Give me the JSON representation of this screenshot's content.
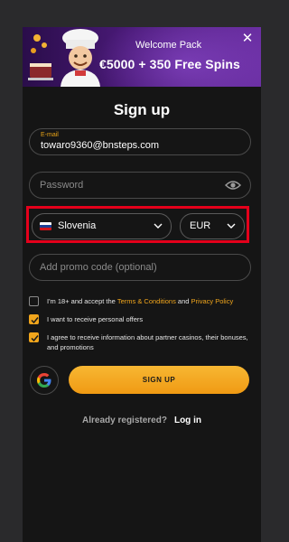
{
  "banner": {
    "title": "Welcome Pack",
    "offer": "€5000 + 350 Free Spins",
    "close_icon": "close-icon"
  },
  "form": {
    "heading": "Sign up",
    "email": {
      "label": "E-mail",
      "value": "towaro9360@bnsteps.com"
    },
    "password": {
      "placeholder": "Password",
      "toggle_icon": "eye-icon"
    },
    "country": {
      "value": "Slovenia",
      "flag_icon": "slovenia-flag-icon"
    },
    "currency": {
      "value": "EUR"
    },
    "promo": {
      "placeholder": "Add promo code (optional)"
    },
    "checkboxes": [
      {
        "checked": false,
        "text_before": "I'm 18+ and accept the ",
        "link1": "Terms & Conditions",
        "mid": " and ",
        "link2": "Privacy Policy"
      },
      {
        "checked": true,
        "text": "I want to receive personal offers"
      },
      {
        "checked": true,
        "text": "I agree to receive information about partner casinos, their bonuses, and promotions"
      }
    ],
    "google_icon": "google-icon",
    "submit_label": "SIGN UP",
    "already_text": "Already registered?",
    "login_label": "Log in"
  },
  "colors": {
    "accent": "#f0a51c",
    "highlight": "#e4001b",
    "background": "#151515"
  }
}
